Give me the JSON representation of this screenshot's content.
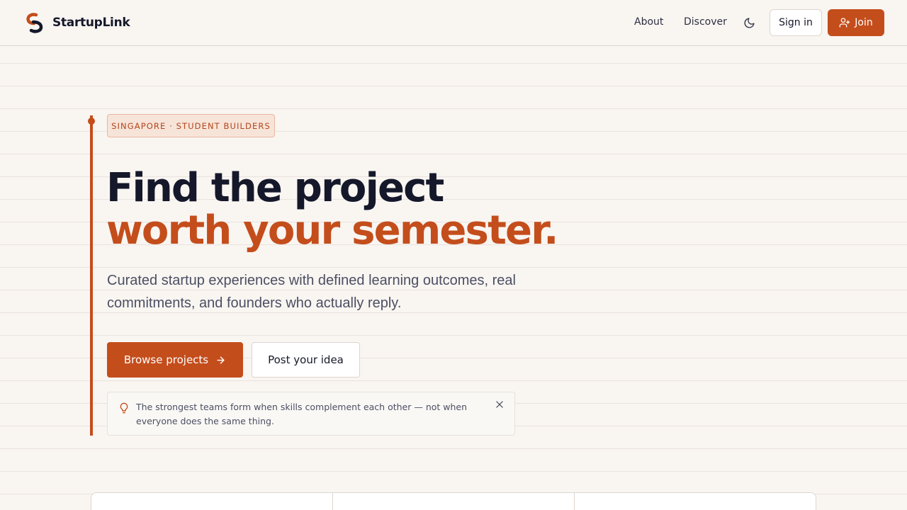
{
  "app": {
    "name": "StartupLink"
  },
  "nav": {
    "about": "About",
    "discover": "Discover",
    "theme_icon": "moon-icon",
    "sign_in": "Sign in",
    "join": "Join",
    "join_icon": "user-plus-icon"
  },
  "hero": {
    "badge": "SINGAPORE · STUDENT BUILDERS",
    "headline_line1": "Find the project",
    "headline_line2": "worth your semester.",
    "subtitle": "Curated startup experiences with defined learning outcomes, real commitments, and founders who actually reply.",
    "primary_cta": "Browse projects",
    "primary_cta_icon": "arrow-right-icon",
    "secondary_cta": "Post your idea"
  },
  "tip": {
    "icon": "lightbulb-icon",
    "text": "The strongest teams form when skills complement each other — not when everyone does the same thing.",
    "close_icon": "close-icon"
  },
  "stats": [
    {},
    {},
    {}
  ],
  "colors": {
    "accent": "#c44d1c",
    "background": "#f9f5f1",
    "text": "#15182a",
    "muted": "#4b4f63"
  }
}
